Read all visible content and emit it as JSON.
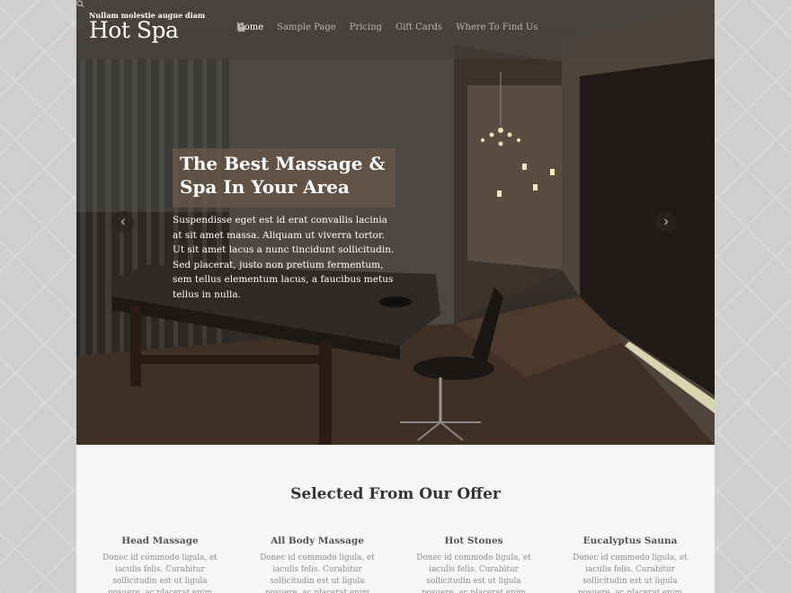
{
  "site": {
    "tagline": "Nullam molestie augue diam",
    "title": "Hot Spa"
  },
  "nav": [
    {
      "label": "Home",
      "icon": "lotus-icon",
      "active": true
    },
    {
      "label": "Sample Page",
      "icon": "flower-icon",
      "active": false
    },
    {
      "label": "Pricing",
      "icon": "pot-icon",
      "active": false
    },
    {
      "label": "Gift Cards",
      "icon": "gift-icon",
      "active": false
    },
    {
      "label": "Where To Find Us",
      "icon": "map-pin-icon",
      "active": false
    }
  ],
  "slider": {
    "title_line1": "The Best Massage &",
    "title_line2": "Spa In Your Area",
    "text": "Suspendisse eget est id erat convallis lacinia at sit amet massa. Aliquam ut viverra tortor. Ut sit amet lacus a nunc tincidunt sollicitudin. Sed placerat, justo non pretium fermentum, sem tellus elementum lacus, a faucibus metus tellus in nulla."
  },
  "offer": {
    "heading": "Selected From Our Offer",
    "items": [
      {
        "title": "Head Massage",
        "text": "Donec id commodo ligula, et iaculis felis. Curabitur sollicitudin est ut ligula posuere, ac placerat enim hendrerit."
      },
      {
        "title": "All Body Massage",
        "text": "Donec id commodo ligula, et iaculis felis. Curabitur sollicitudin est ut ligula posuere, ac placerat enim hendrerit."
      },
      {
        "title": "Hot Stones",
        "text": "Donec id commodo ligula, et iaculis felis. Curabitur sollicitudin est ut ligula posuere, ac placerat enim hendrerit."
      },
      {
        "title": "Eucalyptus Sauna",
        "text": "Donec id commodo ligula, et iaculis felis. Curabitur sollicitudin est ut ligula posuere, ac placerat enim hendrerit."
      }
    ]
  },
  "colors": {
    "caption_bg": "#695846",
    "nav_active": "#ffffff",
    "nav_inactive": "#b8b4ae"
  }
}
